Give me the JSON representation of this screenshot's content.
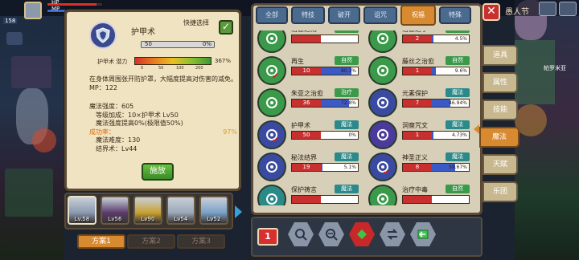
{
  "hud": {
    "close_glyph": "✕",
    "right_label": "愚人节",
    "map_label": "帕罗米亚",
    "hp_label": "HP",
    "mp_label": "MP",
    "num_left": "158"
  },
  "detail": {
    "skill_name": "护甲术",
    "quick_select_label": "快捷选择",
    "quick_select_checked": true,
    "check_glyph": "✓",
    "level": "50",
    "level_progress": "0%",
    "potential_label": "护甲术 潜力",
    "potential_pct": "367%",
    "potential_ticks": [
      "0",
      "50",
      "100",
      "200"
    ],
    "description": "在身体周围张开防护罩，大幅度提高对伤害的减免。MP：122",
    "stats": {
      "magic_power": "魔法强度：605",
      "level_bonus": "等级加成：10×护甲术 Lv50",
      "power_boost": "魔法强度提高0%(极限值50%)",
      "success_rate_label": "成功率：",
      "success_rate_value": "97%",
      "difficulty": "魔法难度：130",
      "barrier": "结界术：Lv44"
    },
    "cast_button": "施放"
  },
  "party": {
    "members": [
      {
        "level": "Lv.58",
        "color": "#8a98b0"
      },
      {
        "level": "Lv56",
        "color": "#5a3a6a"
      },
      {
        "level": "Lv90",
        "color": "#c8a030"
      },
      {
        "level": "Lv54",
        "color": "#9aa8b8"
      },
      {
        "level": "Lv52",
        "color": "#7aa0c8"
      }
    ],
    "plans": [
      "方案1",
      "方案2",
      "方案3"
    ]
  },
  "tabs": [
    "全部",
    "特技",
    "破开",
    "诅咒",
    "祝福",
    "特殊"
  ],
  "active_tab": "祝福",
  "skills": [
    {
      "name": "治愈之雨",
      "type": "治疗",
      "type_color": "green",
      "icon_color": "green",
      "level": "",
      "pct": "",
      "bar": 0,
      "pinned": false
    },
    {
      "name": "治愈之手",
      "type": "治疗",
      "type_color": "green",
      "icon_color": "green",
      "level": "2",
      "pct": "4.5%",
      "bar": 0.045,
      "pinned": false
    },
    {
      "name": "再生",
      "type": "自然",
      "type_color": "green",
      "icon_color": "green",
      "level": "10",
      "pct": "80.1%",
      "bar": 0.801,
      "pinned": true
    },
    {
      "name": "藤丝之治愈",
      "type": "自然",
      "type_color": "green",
      "icon_color": "green",
      "level": "1",
      "pct": "9.6%",
      "bar": 0.096,
      "pinned": false
    },
    {
      "name": "朱亚之治愈",
      "type": "治疗",
      "type_color": "green",
      "icon_color": "green",
      "level": "36",
      "pct": "72.8%",
      "bar": 0.728,
      "pinned": false
    },
    {
      "name": "元素保护",
      "type": "魔法",
      "type_color": "teal",
      "icon_color": "blue",
      "level": "7",
      "pct": "46.94%",
      "bar": 0.4694,
      "pinned": false
    },
    {
      "name": "护甲术",
      "type": "魔法",
      "type_color": "teal",
      "icon_color": "blue",
      "level": "50",
      "pct": "0%",
      "bar": 0,
      "pinned": true
    },
    {
      "name": "洞察咒文",
      "type": "魔法",
      "type_color": "teal",
      "icon_color": "purple",
      "level": "1",
      "pct": "4.73%",
      "bar": 0.0473,
      "pinned": false
    },
    {
      "name": "秘法结界",
      "type": "魔法",
      "type_color": "teal",
      "icon_color": "blue",
      "level": "19",
      "pct": "5.1%",
      "bar": 0.051,
      "pinned": false
    },
    {
      "name": "神圣正义",
      "type": "魔法",
      "type_color": "teal",
      "icon_color": "blue",
      "level": "8",
      "pct": "59.67%",
      "bar": 0.5967,
      "pinned": true
    },
    {
      "name": "保护祷言",
      "type": "魔法",
      "type_color": "teal",
      "icon_color": "teal",
      "level": "",
      "pct": "",
      "bar": 0,
      "pinned": false
    },
    {
      "name": "治疗中毒",
      "type": "自然",
      "type_color": "green",
      "icon_color": "green",
      "level": "",
      "pct": "",
      "bar": 0,
      "pinned": false
    }
  ],
  "side_tabs": [
    "道具",
    "属性",
    "技能",
    "魔法",
    "天赋",
    "乐团"
  ],
  "active_side_tab": "魔法",
  "toolbar": {
    "sort_label": "1",
    "buttons": [
      "search-magnifier-icon",
      "search-filter-icon",
      "gem-icon",
      "swap-icon",
      "back-arrow-icon"
    ]
  }
}
